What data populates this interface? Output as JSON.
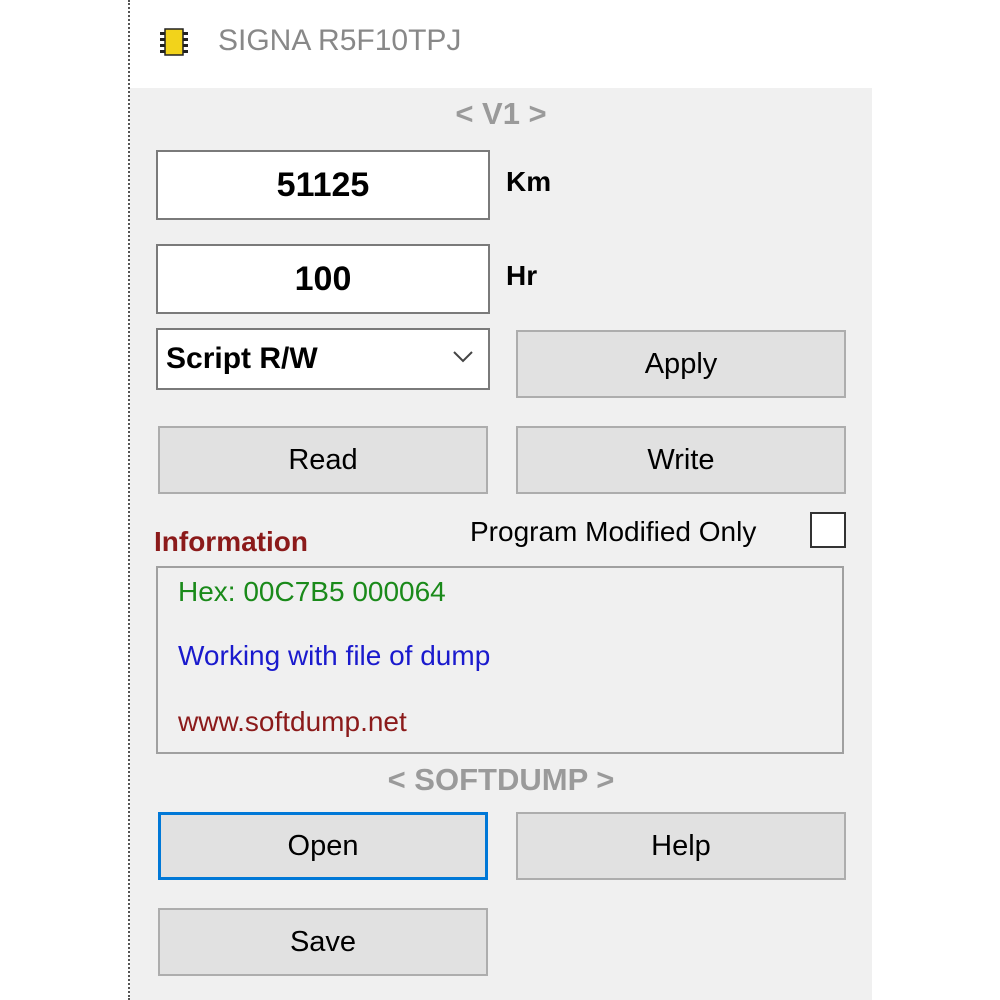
{
  "window": {
    "title": "SIGNA R5F10TPJ",
    "icon": "chip-icon"
  },
  "version_header": "< V1 >",
  "odometer": {
    "km_value": "51125",
    "km_unit": "Km",
    "hr_value": "100",
    "hr_unit": "Hr"
  },
  "mode_select": {
    "selected": "Script R/W"
  },
  "buttons": {
    "apply": "Apply",
    "read": "Read",
    "write": "Write",
    "open": "Open",
    "help": "Help",
    "save": "Save"
  },
  "information": {
    "label": "Information",
    "checkbox_label": "Program Modified Only",
    "checkbox_checked": false,
    "lines": [
      {
        "text": "Hex: 00C7B5  000064",
        "color": "#1a8a1a"
      },
      {
        "text": "Working with file of dump",
        "color": "#1a1acd"
      },
      {
        "text": "www.softdump.net",
        "color": "#8b1a1a"
      }
    ]
  },
  "footer_header": "< SOFTDUMP >",
  "colors": {
    "info_label": "#8b1a1a",
    "header_gray": "#9a9a9a",
    "focus_border": "#0078d7",
    "button_face": "#e1e1e1"
  }
}
